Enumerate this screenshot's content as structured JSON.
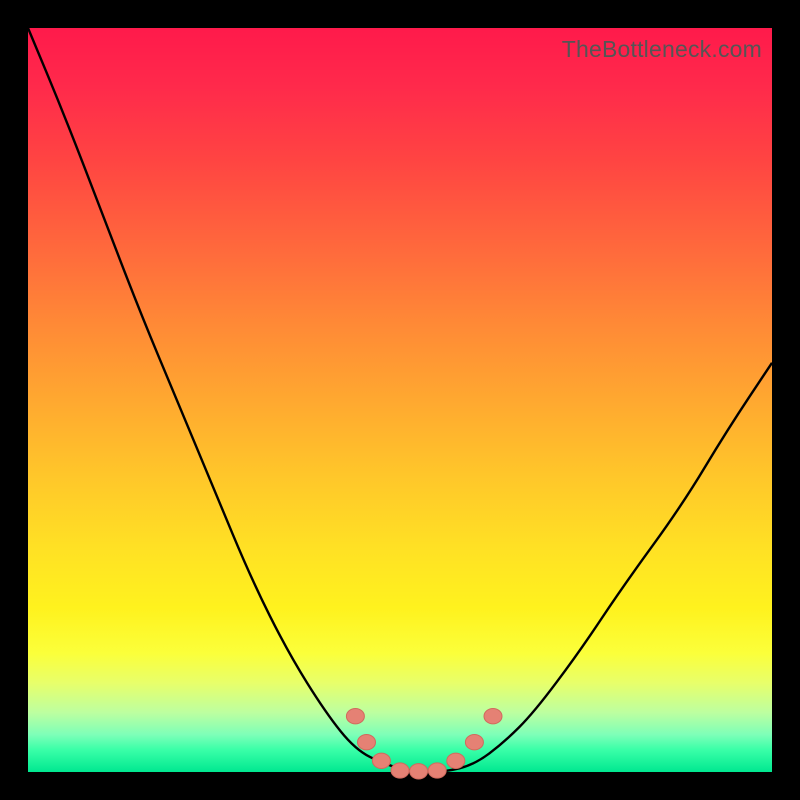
{
  "watermark": "TheBottleneck.com",
  "colors": {
    "gradient_top": "#ff1a4b",
    "gradient_bottom": "#00e890",
    "curve": "#000000",
    "marker_fill": "#e58174",
    "marker_stroke": "#d16a5d"
  },
  "chart_data": {
    "type": "line",
    "title": "",
    "xlabel": "",
    "ylabel": "",
    "xlim": [
      0,
      1
    ],
    "ylim": [
      0,
      1
    ],
    "series": [
      {
        "name": "bottleneck-curve",
        "x": [
          0.0,
          0.05,
          0.1,
          0.15,
          0.2,
          0.25,
          0.3,
          0.35,
          0.4,
          0.44,
          0.48,
          0.52,
          0.56,
          0.6,
          0.64,
          0.68,
          0.74,
          0.8,
          0.88,
          0.94,
          1.0
        ],
        "y": [
          1.0,
          0.88,
          0.75,
          0.62,
          0.5,
          0.38,
          0.26,
          0.16,
          0.08,
          0.03,
          0.01,
          0.0,
          0.0,
          0.01,
          0.04,
          0.08,
          0.16,
          0.25,
          0.36,
          0.46,
          0.55
        ]
      }
    ],
    "markers": {
      "name": "highlight-points",
      "x": [
        0.44,
        0.455,
        0.475,
        0.5,
        0.525,
        0.55,
        0.575,
        0.6,
        0.625
      ],
      "y": [
        0.075,
        0.04,
        0.015,
        0.002,
        0.001,
        0.002,
        0.015,
        0.04,
        0.075
      ]
    }
  }
}
